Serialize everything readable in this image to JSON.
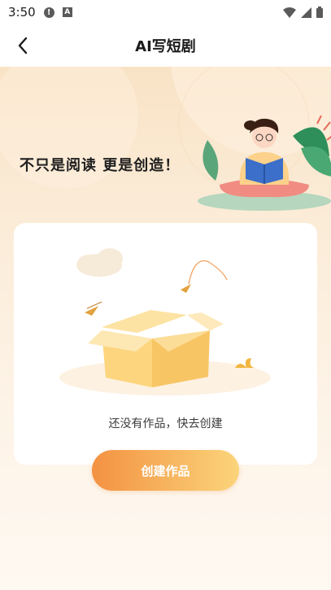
{
  "status_bar": {
    "time": "3:50",
    "icons": [
      "alert-icon",
      "a-icon",
      "wifi-icon",
      "signal-icon",
      "battery-icon"
    ]
  },
  "nav": {
    "title": "AI写短剧",
    "back_icon": "chevron-left-icon"
  },
  "hero": {
    "slogan": "不只是阅读  更是创造！"
  },
  "empty_state": {
    "message": "还没有作品，快去创建",
    "illustration": "empty-box-icon"
  },
  "actions": {
    "create_label": "创建作品"
  },
  "colors": {
    "accent_start": "#f39242",
    "accent_end": "#fbd47a",
    "background": "#fbf1e4"
  }
}
